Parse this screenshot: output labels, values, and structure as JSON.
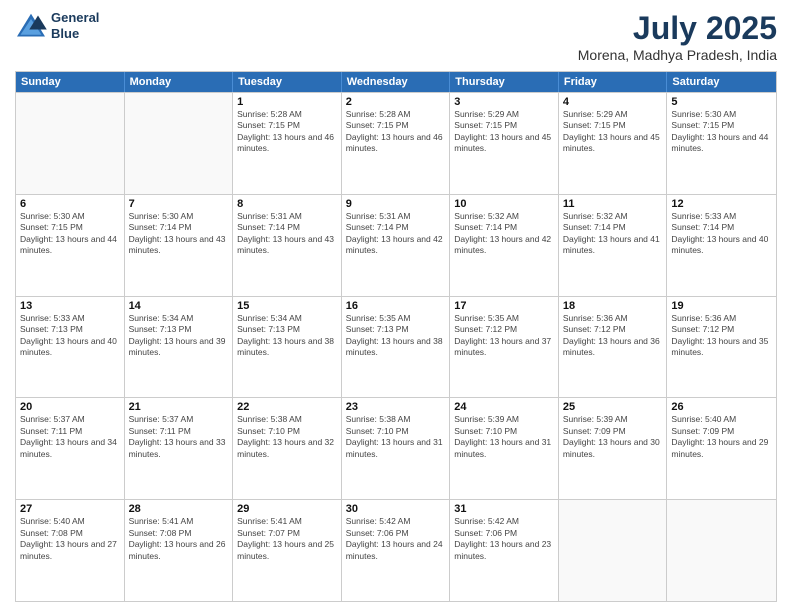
{
  "logo": {
    "line1": "General",
    "line2": "Blue"
  },
  "title": "July 2025",
  "subtitle": "Morena, Madhya Pradesh, India",
  "header": {
    "days": [
      "Sunday",
      "Monday",
      "Tuesday",
      "Wednesday",
      "Thursday",
      "Friday",
      "Saturday"
    ]
  },
  "rows": [
    [
      {
        "day": "",
        "info": ""
      },
      {
        "day": "",
        "info": ""
      },
      {
        "day": "1",
        "info": "Sunrise: 5:28 AM\nSunset: 7:15 PM\nDaylight: 13 hours and 46 minutes."
      },
      {
        "day": "2",
        "info": "Sunrise: 5:28 AM\nSunset: 7:15 PM\nDaylight: 13 hours and 46 minutes."
      },
      {
        "day": "3",
        "info": "Sunrise: 5:29 AM\nSunset: 7:15 PM\nDaylight: 13 hours and 45 minutes."
      },
      {
        "day": "4",
        "info": "Sunrise: 5:29 AM\nSunset: 7:15 PM\nDaylight: 13 hours and 45 minutes."
      },
      {
        "day": "5",
        "info": "Sunrise: 5:30 AM\nSunset: 7:15 PM\nDaylight: 13 hours and 44 minutes."
      }
    ],
    [
      {
        "day": "6",
        "info": "Sunrise: 5:30 AM\nSunset: 7:15 PM\nDaylight: 13 hours and 44 minutes."
      },
      {
        "day": "7",
        "info": "Sunrise: 5:30 AM\nSunset: 7:14 PM\nDaylight: 13 hours and 43 minutes."
      },
      {
        "day": "8",
        "info": "Sunrise: 5:31 AM\nSunset: 7:14 PM\nDaylight: 13 hours and 43 minutes."
      },
      {
        "day": "9",
        "info": "Sunrise: 5:31 AM\nSunset: 7:14 PM\nDaylight: 13 hours and 42 minutes."
      },
      {
        "day": "10",
        "info": "Sunrise: 5:32 AM\nSunset: 7:14 PM\nDaylight: 13 hours and 42 minutes."
      },
      {
        "day": "11",
        "info": "Sunrise: 5:32 AM\nSunset: 7:14 PM\nDaylight: 13 hours and 41 minutes."
      },
      {
        "day": "12",
        "info": "Sunrise: 5:33 AM\nSunset: 7:14 PM\nDaylight: 13 hours and 40 minutes."
      }
    ],
    [
      {
        "day": "13",
        "info": "Sunrise: 5:33 AM\nSunset: 7:13 PM\nDaylight: 13 hours and 40 minutes."
      },
      {
        "day": "14",
        "info": "Sunrise: 5:34 AM\nSunset: 7:13 PM\nDaylight: 13 hours and 39 minutes."
      },
      {
        "day": "15",
        "info": "Sunrise: 5:34 AM\nSunset: 7:13 PM\nDaylight: 13 hours and 38 minutes."
      },
      {
        "day": "16",
        "info": "Sunrise: 5:35 AM\nSunset: 7:13 PM\nDaylight: 13 hours and 38 minutes."
      },
      {
        "day": "17",
        "info": "Sunrise: 5:35 AM\nSunset: 7:12 PM\nDaylight: 13 hours and 37 minutes."
      },
      {
        "day": "18",
        "info": "Sunrise: 5:36 AM\nSunset: 7:12 PM\nDaylight: 13 hours and 36 minutes."
      },
      {
        "day": "19",
        "info": "Sunrise: 5:36 AM\nSunset: 7:12 PM\nDaylight: 13 hours and 35 minutes."
      }
    ],
    [
      {
        "day": "20",
        "info": "Sunrise: 5:37 AM\nSunset: 7:11 PM\nDaylight: 13 hours and 34 minutes."
      },
      {
        "day": "21",
        "info": "Sunrise: 5:37 AM\nSunset: 7:11 PM\nDaylight: 13 hours and 33 minutes."
      },
      {
        "day": "22",
        "info": "Sunrise: 5:38 AM\nSunset: 7:10 PM\nDaylight: 13 hours and 32 minutes."
      },
      {
        "day": "23",
        "info": "Sunrise: 5:38 AM\nSunset: 7:10 PM\nDaylight: 13 hours and 31 minutes."
      },
      {
        "day": "24",
        "info": "Sunrise: 5:39 AM\nSunset: 7:10 PM\nDaylight: 13 hours and 31 minutes."
      },
      {
        "day": "25",
        "info": "Sunrise: 5:39 AM\nSunset: 7:09 PM\nDaylight: 13 hours and 30 minutes."
      },
      {
        "day": "26",
        "info": "Sunrise: 5:40 AM\nSunset: 7:09 PM\nDaylight: 13 hours and 29 minutes."
      }
    ],
    [
      {
        "day": "27",
        "info": "Sunrise: 5:40 AM\nSunset: 7:08 PM\nDaylight: 13 hours and 27 minutes."
      },
      {
        "day": "28",
        "info": "Sunrise: 5:41 AM\nSunset: 7:08 PM\nDaylight: 13 hours and 26 minutes."
      },
      {
        "day": "29",
        "info": "Sunrise: 5:41 AM\nSunset: 7:07 PM\nDaylight: 13 hours and 25 minutes."
      },
      {
        "day": "30",
        "info": "Sunrise: 5:42 AM\nSunset: 7:06 PM\nDaylight: 13 hours and 24 minutes."
      },
      {
        "day": "31",
        "info": "Sunrise: 5:42 AM\nSunset: 7:06 PM\nDaylight: 13 hours and 23 minutes."
      },
      {
        "day": "",
        "info": ""
      },
      {
        "day": "",
        "info": ""
      }
    ]
  ]
}
